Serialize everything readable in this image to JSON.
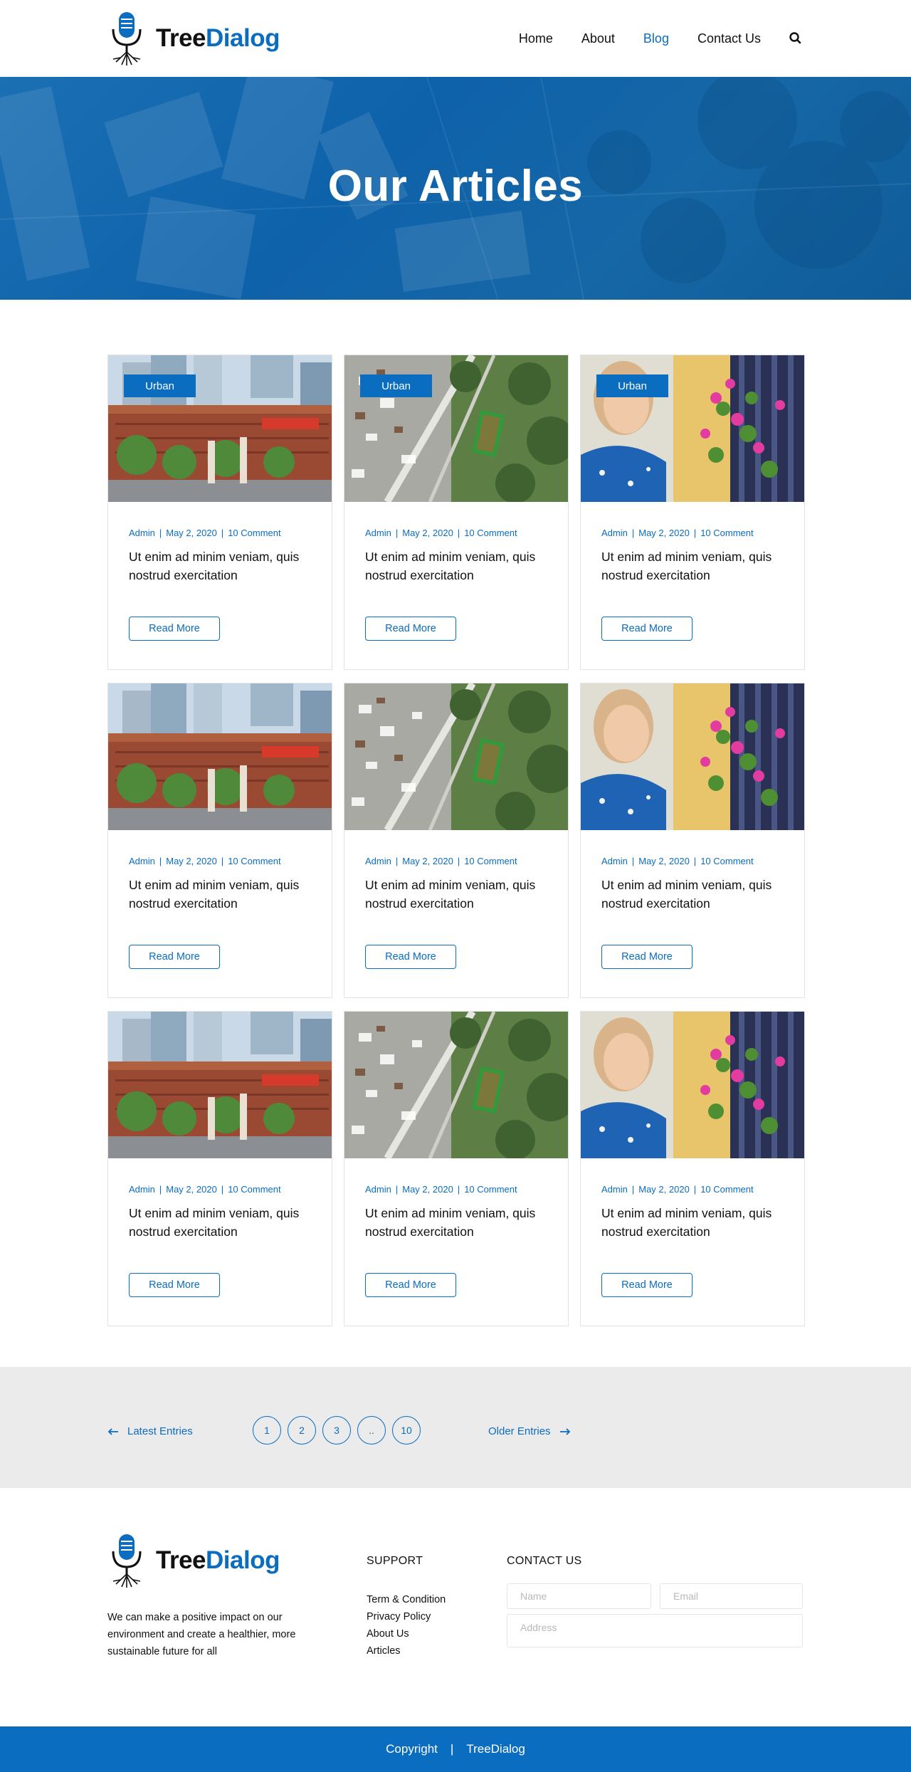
{
  "brand": {
    "name_part1": "Tree",
    "name_part2": "Dialog",
    "accent": "#0a6dbf",
    "icon": "microphone-tree-logo"
  },
  "nav": {
    "items": [
      {
        "label": "Home",
        "active": false
      },
      {
        "label": "About",
        "active": false
      },
      {
        "label": "Blog",
        "active": true
      },
      {
        "label": "Contact Us",
        "active": false
      }
    ],
    "search_icon": "search-icon"
  },
  "hero": {
    "title": "Our Articles"
  },
  "articles": [
    {
      "tag": "Urban",
      "image": "city-building-photo",
      "author": "Admin",
      "date": "May 2, 2020",
      "comments": "10 Comment",
      "title": "Ut enim ad minim veniam, quis nostrud exercitation",
      "button": "Read More"
    },
    {
      "tag": "Urban",
      "image": "aerial-town-photo",
      "author": "Admin",
      "date": "May 2, 2020",
      "comments": "10 Comment",
      "title": "Ut enim ad minim veniam, quis nostrud exercitation",
      "button": "Read More"
    },
    {
      "tag": "Urban",
      "image": "girl-flowers-photo",
      "author": "Admin",
      "date": "May 2, 2020",
      "comments": "10 Comment",
      "title": "Ut enim ad minim veniam, quis nostrud exercitation",
      "button": "Read More"
    },
    {
      "tag": "",
      "image": "city-building-photo",
      "author": "Admin",
      "date": "May 2, 2020",
      "comments": "10 Comment",
      "title": "Ut enim ad minim veniam, quis nostrud exercitation",
      "button": "Read More"
    },
    {
      "tag": "",
      "image": "aerial-town-photo",
      "author": "Admin",
      "date": "May 2, 2020",
      "comments": "10 Comment",
      "title": "Ut enim ad minim veniam, quis nostrud exercitation",
      "button": "Read More"
    },
    {
      "tag": "",
      "image": "girl-flowers-photo",
      "author": "Admin",
      "date": "May 2, 2020",
      "comments": "10 Comment",
      "title": "Ut enim ad minim veniam, quis nostrud exercitation",
      "button": "Read More"
    },
    {
      "tag": "",
      "image": "city-building-photo",
      "author": "Admin",
      "date": "May 2, 2020",
      "comments": "10 Comment",
      "title": "Ut enim ad minim veniam, quis nostrud exercitation",
      "button": "Read More"
    },
    {
      "tag": "",
      "image": "aerial-town-photo",
      "author": "Admin",
      "date": "May 2, 2020",
      "comments": "10 Comment",
      "title": "Ut enim ad minim veniam, quis nostrud exercitation",
      "button": "Read More"
    },
    {
      "tag": "",
      "image": "girl-flowers-photo",
      "author": "Admin",
      "date": "May 2, 2020",
      "comments": "10 Comment",
      "title": "Ut enim ad minim veniam, quis nostrud exercitation",
      "button": "Read More"
    }
  ],
  "pagination": {
    "prev_label": "Latest Entries",
    "next_label": "Older Entries",
    "pages": [
      "1",
      "2",
      "3",
      "..",
      "10"
    ]
  },
  "footer": {
    "description": "We can make a positive impact on our environment and create a healthier, more sustainable future for all",
    "support_heading": "SUPPORT",
    "support_links": [
      "Term & Condition",
      "Privacy Policy",
      "About Us",
      "Articles"
    ],
    "contact_heading": "CONTACT US",
    "name_placeholder": "Name",
    "email_placeholder": "Email",
    "address_placeholder": "Address",
    "copyright": "Copyright",
    "copyright_sep": "|",
    "copyright_brand": "TreeDialog"
  }
}
